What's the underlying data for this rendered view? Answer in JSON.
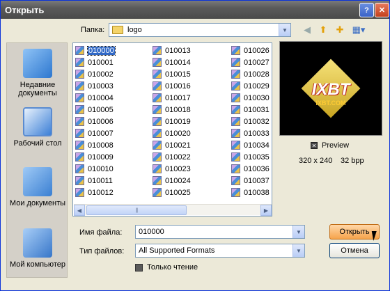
{
  "window": {
    "title": "Открыть"
  },
  "toolbar": {
    "lookin_label": "Папка:",
    "lookin_value": "logo"
  },
  "places": [
    {
      "label": "Недавние документы"
    },
    {
      "label": "Рабочий стол"
    },
    {
      "label": "Мои документы"
    },
    {
      "label": "Мой компьютер"
    }
  ],
  "files": [
    "010000",
    "010001",
    "010002",
    "010003",
    "010004",
    "010005",
    "010006",
    "010007",
    "010008",
    "010009",
    "010010",
    "010011",
    "010012",
    "010013",
    "010014",
    "010015",
    "010016",
    "010017",
    "010018",
    "010019",
    "010020",
    "010021",
    "010022",
    "010023",
    "010024",
    "010025",
    "010026",
    "010027",
    "010028",
    "010029",
    "010030",
    "010031",
    "010032",
    "010033",
    "010034",
    "010035",
    "010036",
    "010037",
    "010038"
  ],
  "selected_file": "010000",
  "preview": {
    "logo_main": "IXBT",
    "logo_sub": "IXBT.COM",
    "toggle_label": "Preview",
    "dimensions": "320 x 240",
    "bpp": "32 bpp"
  },
  "filename": {
    "label": "Имя файла:",
    "value": "010000"
  },
  "filetype": {
    "label": "Тип файлов:",
    "value": "All Supported Formats"
  },
  "readonly": {
    "label": "Только чтение"
  },
  "buttons": {
    "open": "Открыть",
    "cancel": "Отмена"
  }
}
